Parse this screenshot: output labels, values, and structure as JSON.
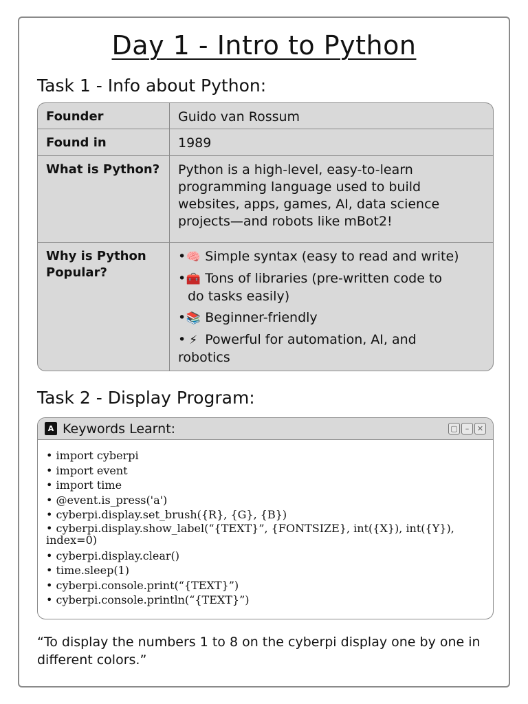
{
  "title": "Day 1 - Intro to Python",
  "task1": {
    "heading": "Task 1 - Info about Python:",
    "rows": {
      "founder": {
        "label": "Founder",
        "value": "Guido van Rossum"
      },
      "found_in": {
        "label": "Found in",
        "value": "1989"
      },
      "what": {
        "label": "What is Python?",
        "value": "Python is a high-level, easy-to-learn programming language used to build websites, apps, games, AI, data science projects—and robots like mBot2!"
      },
      "why": {
        "label": "Why is Python Popular?",
        "bullets": [
          {
            "icon": "🧠",
            "icon_name": "brain-icon",
            "text": "Simple syntax (easy to read and write)"
          },
          {
            "icon": "🧰",
            "icon_name": "toolbox-icon",
            "text": "Tons of libraries (pre-written code to",
            "text2": "do tasks easily)"
          },
          {
            "icon": "📚",
            "icon_name": "books-icon",
            "text": "Beginner-friendly"
          },
          {
            "icon": "⚡",
            "icon_name": "lightning-icon",
            "text": "Powerful for automation, AI, and",
            "text2": "robotics"
          }
        ]
      }
    }
  },
  "task2": {
    "heading": "Task 2 - Display Program:",
    "panel_title": "Keywords Learnt:",
    "keywords": [
      "import cyberpi",
      "import event",
      "import time",
      "@event.is_press('a')",
      "cyberpi.display.set_brush({R}, {G}, {B})",
      "cyberpi.display.show_label(“{TEXT}”, {FONTSIZE}, int({X}), int({Y}), index=0)",
      "cyberpi.display.clear()",
      "time.sleep(1)",
      "cyberpi.console.print(“{TEXT}”)",
      "cyberpi.console.println(“{TEXT}”)"
    ]
  },
  "quote": "“To display the numbers 1 to 8 on the cyberpi display one by one in different colors.”"
}
